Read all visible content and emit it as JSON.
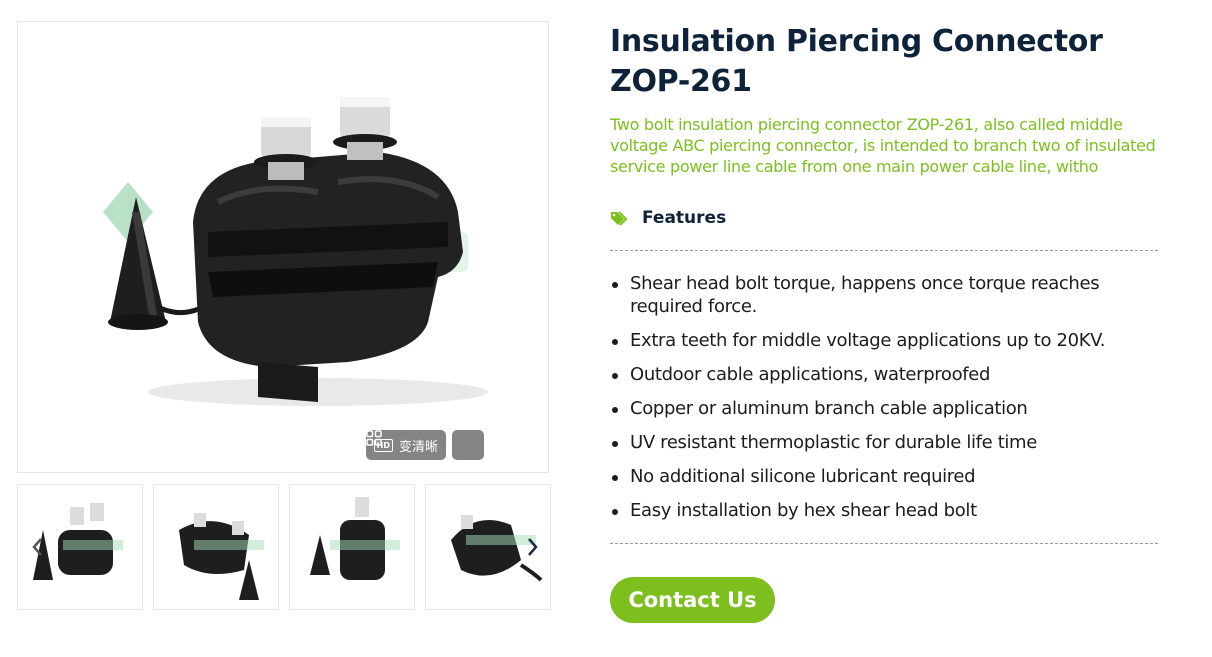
{
  "product": {
    "title": "Insulation Piercing Connector ZOP-261",
    "description": "Two bolt insulation piercing connector ZOP-261, also called middle voltage ABC piercing connector, is intended to branch two of insulated service power line cable from one main power cable line, witho"
  },
  "gallery": {
    "hd_label": "变清晰",
    "hd_badge": "HD",
    "thumbnail_count": 4
  },
  "features": {
    "heading": "Features",
    "items": [
      "Shear head bolt torque, happens once torque reaches required force.",
      "Extra teeth for middle voltage applications up to 20KV.",
      "Outdoor cable applications, waterproofed",
      "Copper or aluminum branch cable application",
      "UV resistant thermoplastic for durable life time",
      "No additional silicone lubricant required",
      "Easy installation by hex shear head bolt"
    ]
  },
  "contact": {
    "label": "Contact Us"
  },
  "colors": {
    "accent": "#7cbf1e",
    "title": "#0e2239"
  },
  "icons": {
    "features": "tags-icon",
    "grid": "grid-icon",
    "prev": "chevron-left-icon",
    "next": "chevron-right-icon"
  }
}
